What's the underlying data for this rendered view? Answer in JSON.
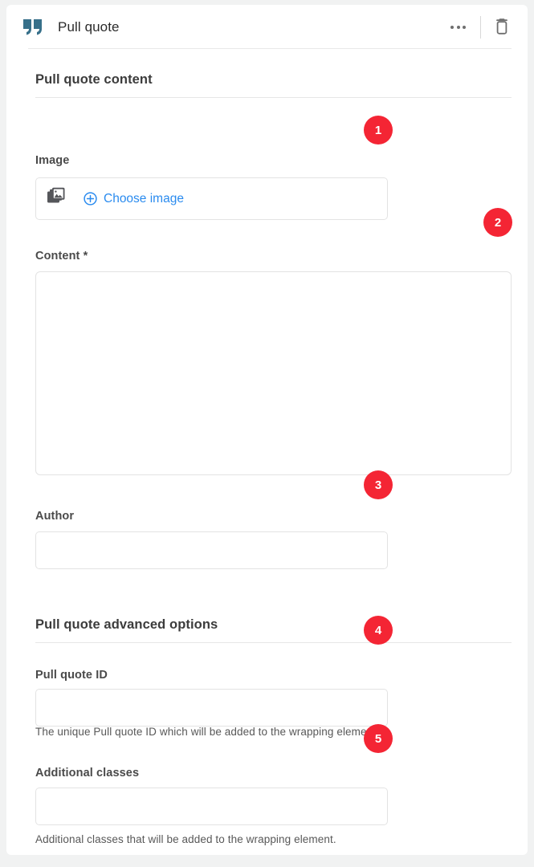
{
  "window": {
    "background_color": "#f1f2f2",
    "card_background": "#ffffff"
  },
  "header": {
    "icon": "pull-quote-icon",
    "title": "Pull quote",
    "icon_color": "#37708a",
    "actions": [
      {
        "name": "more-options",
        "icon": "ellipsis-icon",
        "label": ""
      },
      {
        "name": "delete-block",
        "icon": "trash-icon",
        "label": ""
      }
    ]
  },
  "sections": [
    {
      "title": "Pull quote content",
      "fields": [
        {
          "label": "Image",
          "type": "image-picker",
          "button_label": "Choose image",
          "link_color": "#2a8bef",
          "value": ""
        },
        {
          "label": "Content *",
          "type": "textarea",
          "value": "",
          "placeholder": ""
        },
        {
          "label": "Author",
          "type": "text",
          "value": "",
          "placeholder": ""
        }
      ]
    },
    {
      "title": "Pull quote advanced options",
      "fields": [
        {
          "label": "Pull quote ID",
          "type": "text",
          "value": "",
          "placeholder": "",
          "help": "The unique Pull quote ID which will be added to the wrapping element."
        },
        {
          "label": "Additional classes",
          "type": "text",
          "value": "",
          "placeholder": "",
          "help": "Additional classes that will be added to the wrapping element."
        }
      ]
    }
  ],
  "badges": [
    {
      "number": "1",
      "target": "choose-image-field"
    },
    {
      "number": "2",
      "target": "content-textarea"
    },
    {
      "number": "3",
      "target": "author-input"
    },
    {
      "number": "4",
      "target": "pull-quote-id-input"
    },
    {
      "number": "5",
      "target": "additional-classes-input"
    }
  ],
  "badge_color": "#f42534"
}
